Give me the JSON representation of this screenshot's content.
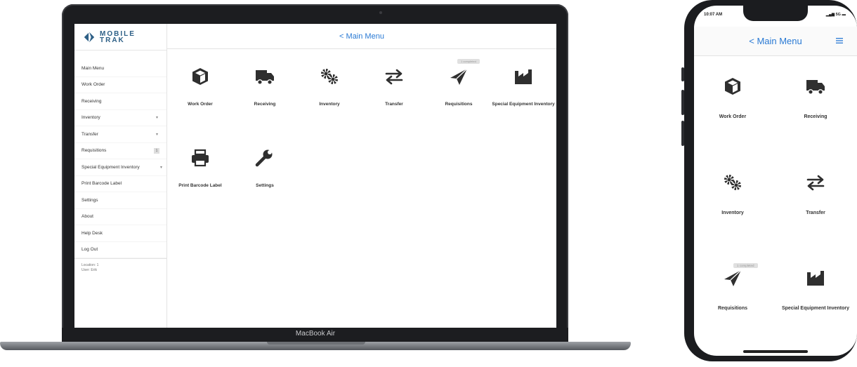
{
  "laptop": {
    "model_label": "MacBook Air",
    "app": {
      "logo": {
        "line1": "MOBILE",
        "line2": "TRAK"
      },
      "header": {
        "back_label": "< Main Menu"
      },
      "sidebar": {
        "items": [
          {
            "label": "Main Menu"
          },
          {
            "label": "Work Order"
          },
          {
            "label": "Receiving"
          },
          {
            "label": "Inventory",
            "caret": "▾"
          },
          {
            "label": "Transfer",
            "caret": "▾"
          },
          {
            "label": "Requisitions",
            "badge": "1"
          },
          {
            "label": "Special Equipment Inventory",
            "caret": "▾"
          },
          {
            "label": "Print Barcode Label"
          },
          {
            "label": "Settings"
          },
          {
            "label": "About"
          },
          {
            "label": "Help Desk"
          },
          {
            "label": "Log Out"
          }
        ],
        "footer": {
          "location": "Location: 1",
          "user": "User: Erik"
        }
      },
      "tiles": [
        {
          "label": "Work Order",
          "icon": "box-icon"
        },
        {
          "label": "Receiving",
          "icon": "truck-icon"
        },
        {
          "label": "Inventory",
          "icon": "gears-icon"
        },
        {
          "label": "Transfer",
          "icon": "transfer-arrows-icon"
        },
        {
          "label": "Requisitions",
          "icon": "paper-plane-icon",
          "pill": "1 completed"
        },
        {
          "label": "Special Equipment Inventory",
          "icon": "factory-icon"
        },
        {
          "label": "Print Barcode Label",
          "icon": "printer-icon"
        },
        {
          "label": "Settings",
          "icon": "wrench-icon"
        }
      ]
    }
  },
  "phone": {
    "status": {
      "time": "10:07 AM",
      "signal": "5G"
    },
    "header": {
      "back_label": "< Main Menu"
    },
    "tiles": [
      {
        "label": "Work Order",
        "icon": "box-icon"
      },
      {
        "label": "Receiving",
        "icon": "truck-icon"
      },
      {
        "label": "Inventory",
        "icon": "gears-icon"
      },
      {
        "label": "Transfer",
        "icon": "transfer-arrows-icon"
      },
      {
        "label": "Requisitions",
        "icon": "paper-plane-icon",
        "pill": "1 completed"
      },
      {
        "label": "Special Equipment Inventory",
        "icon": "factory-icon"
      }
    ]
  },
  "colors": {
    "accent": "#2a7ad4",
    "icon": "#2f2f2f",
    "brand": "#2d5f86"
  }
}
